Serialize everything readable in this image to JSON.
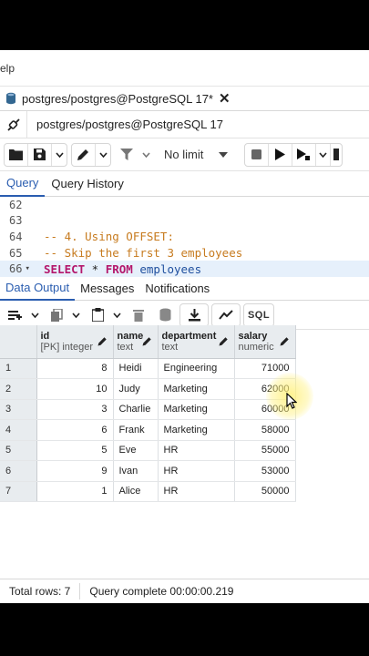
{
  "menubar": {
    "help_label": "elp"
  },
  "doc_tab": {
    "title": "postgres/postgres@PostgreSQL 17*"
  },
  "connection": {
    "label": "postgres/postgres@PostgreSQL 17"
  },
  "toolbar": {
    "limit_value": "No limit"
  },
  "query_tabs": [
    {
      "label": "Query"
    },
    {
      "label": "Query History"
    }
  ],
  "editor": {
    "lines": [
      {
        "num": "62",
        "text": ""
      },
      {
        "num": "63",
        "text": ""
      },
      {
        "num": "64",
        "text": "-- 4. Using OFFSET:"
      },
      {
        "num": "65",
        "text": "-- Skip the first 3 employees"
      },
      {
        "num": "66",
        "kw1": "SELECT",
        "star": " * ",
        "kw2": "FROM",
        "ident": " employees"
      }
    ]
  },
  "output_tabs": [
    {
      "label": "Data Output"
    },
    {
      "label": "Messages"
    },
    {
      "label": "Notifications"
    }
  ],
  "grid": {
    "sql_label": "SQL",
    "columns": [
      {
        "name": "id",
        "type": "[PK] integer"
      },
      {
        "name": "name",
        "type": "text"
      },
      {
        "name": "department",
        "type": "text"
      },
      {
        "name": "salary",
        "type": "numeric"
      }
    ],
    "rows": [
      {
        "n": "1",
        "id": "8",
        "name": "Heidi",
        "department": "Engineering",
        "salary": "71000"
      },
      {
        "n": "2",
        "id": "10",
        "name": "Judy",
        "department": "Marketing",
        "salary": "62000"
      },
      {
        "n": "3",
        "id": "3",
        "name": "Charlie",
        "department": "Marketing",
        "salary": "60000"
      },
      {
        "n": "4",
        "id": "6",
        "name": "Frank",
        "department": "Marketing",
        "salary": "58000"
      },
      {
        "n": "5",
        "id": "5",
        "name": "Eve",
        "department": "HR",
        "salary": "55000"
      },
      {
        "n": "6",
        "id": "9",
        "name": "Ivan",
        "department": "HR",
        "salary": "53000"
      },
      {
        "n": "7",
        "id": "1",
        "name": "Alice",
        "department": "HR",
        "salary": "50000"
      }
    ]
  },
  "status": {
    "total_rows": "Total rows: 7",
    "query_complete": "Query complete 00:00:00.219"
  }
}
